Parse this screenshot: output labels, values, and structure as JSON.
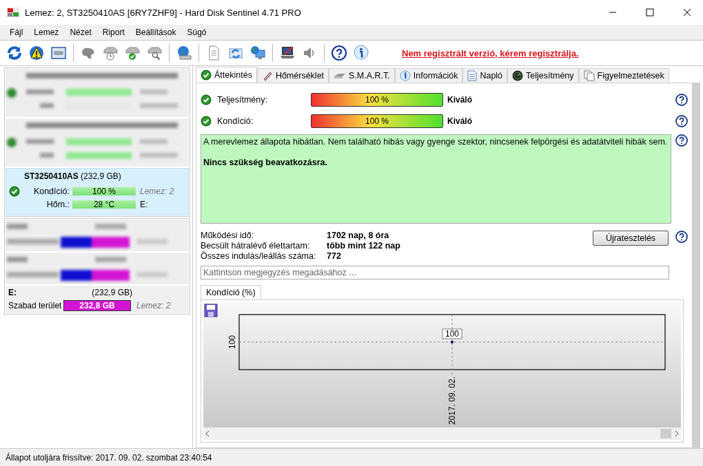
{
  "window": {
    "title": "Lemez: 2, ST3250410AS [6RY7ZHF9]  -  Hard Disk Sentinel 4.71 PRO"
  },
  "menu": [
    "Fájl",
    "Lemez",
    "Nézet",
    "Riport",
    "Beállítások",
    "Súgó"
  ],
  "register_link": "Nem regisztrált verzió, kérem regisztrálja.",
  "disks": [
    {
      "kind": "blurred"
    },
    {
      "kind": "blurred"
    },
    {
      "kind": "disk",
      "ok": true,
      "selected": true,
      "name": "ST3250410AS",
      "size": "(232,9 GB)",
      "rows": [
        {
          "label": "Kondíció:",
          "value": "100 %",
          "level": 1,
          "note": "Lemez: 2",
          "note_italic": true
        },
        {
          "label": "Hőm.:",
          "value": "28 °C",
          "level": 1,
          "note": "E:",
          "note_italic": false
        }
      ]
    }
  ],
  "volumes": [
    {
      "kind": "blurred"
    },
    {
      "kind": "blurred"
    },
    {
      "kind": "volume",
      "name": "E:",
      "size": "(232,9 GB)",
      "label": "Szabad terület",
      "value": "232,8 GB",
      "level": 1,
      "note": "Lemez: 2"
    }
  ],
  "tabs": [
    {
      "label": "Áttekintés",
      "selected": true
    },
    {
      "label": "Hőmérséklet",
      "selected": false
    },
    {
      "label": "S.M.A.R.T.",
      "selected": false
    },
    {
      "label": "Információk",
      "selected": false
    },
    {
      "label": "Napló",
      "selected": false
    },
    {
      "label": "Teljesítmény",
      "selected": false
    },
    {
      "label": "Figyelmeztetések",
      "selected": false
    }
  ],
  "meters": [
    {
      "label": "Teljesítmény:",
      "value": "100 %",
      "level": 1,
      "rating": "Kiváló"
    },
    {
      "label": "Kondíció:",
      "value": "100 %",
      "level": 1,
      "rating": "Kiváló"
    }
  ],
  "summary": {
    "text": "A merevlemez állapota hibátlan. Nem található hibás vagy gyenge szektor, nincsenek felpörgési és adatátviteli hibák sem.",
    "conclusion": "Nincs szükség beavatkozásra."
  },
  "stats": [
    {
      "label": "Működési idő:",
      "value": "1702 nap, 8 óra"
    },
    {
      "label": "Becsült hátralévő élettartam:",
      "value": "több mint 122 nap"
    },
    {
      "label": "Összes indulás/leállás száma:",
      "value": "772"
    }
  ],
  "retest_button": "Újratesztelés",
  "note_field": {
    "placeholder": "Kattintson megjegyzés megadásához ..."
  },
  "chart_tab": "Kondíció  (%)",
  "chart": {
    "y_tick": "100",
    "x_label": "2017. 09. 02.",
    "point_label": "100"
  },
  "status_bar": "Állapot utoljára frissítve: 2017. 09. 02. szombat 23:40:54"
}
